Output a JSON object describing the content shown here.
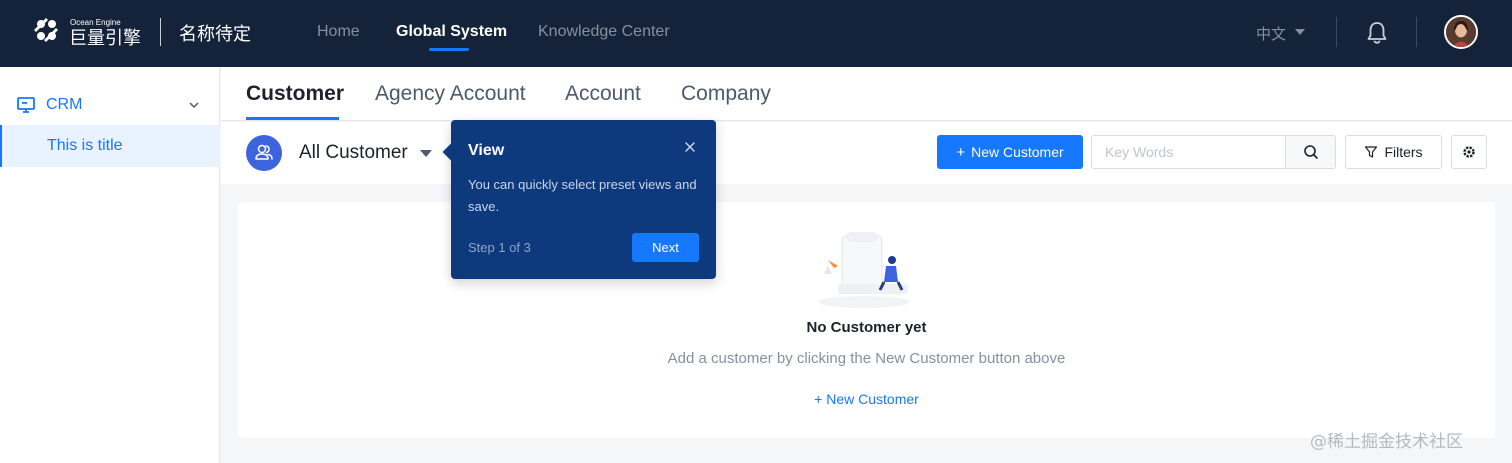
{
  "header": {
    "logo_tagline": "Ocean Engine",
    "logo_text": "巨量引擎",
    "app_name": "名称待定",
    "nav": [
      {
        "label": "Home",
        "active": false
      },
      {
        "label": "Global System",
        "active": true
      },
      {
        "label": "Knowledge Center",
        "active": false
      }
    ],
    "language": "中文"
  },
  "sidebar": {
    "group_label": "CRM",
    "items": [
      {
        "label": "This is title",
        "active": true
      }
    ]
  },
  "tabs": [
    {
      "label": "Customer",
      "active": true
    },
    {
      "label": "Agency Account",
      "active": false
    },
    {
      "label": "Account",
      "active": false
    },
    {
      "label": "Company",
      "active": false
    }
  ],
  "toolbar": {
    "view_label": "All Customer",
    "new_button_label": "New Customer",
    "search_placeholder": "Key Words",
    "filter_label": "Filters"
  },
  "empty_state": {
    "title": "No Customer yet",
    "description": "Add a customer by clicking the New Customer button above",
    "link_label": "New Customer"
  },
  "popover": {
    "title": "View",
    "body": "You can quickly select preset views and save.",
    "step": "Step 1 of 3",
    "next_label": "Next"
  },
  "watermark": "@稀土掘金技术社区",
  "colors": {
    "topbar": "#14223a",
    "accent": "#1677ff",
    "popover": "#0e3a7d"
  }
}
